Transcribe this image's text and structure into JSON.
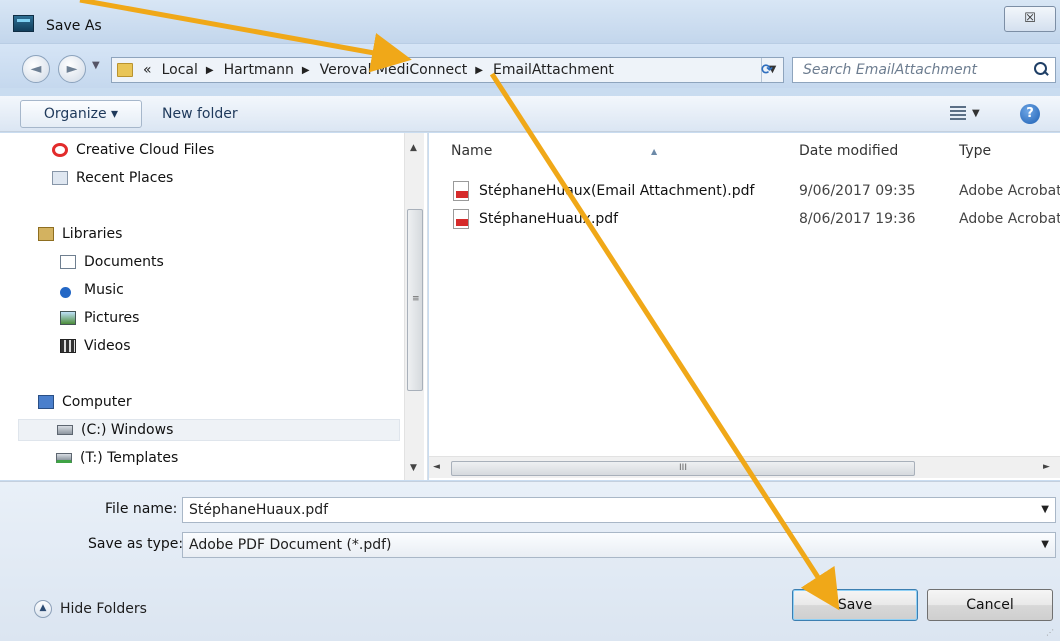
{
  "window": {
    "title": "Save As",
    "close_glyph": "☒"
  },
  "navigation": {
    "back_glyph": "◄",
    "forward_glyph": "►",
    "breadcrumb": [
      "«",
      "Local",
      "Hartmann",
      "Veroval MediConnect",
      "EmailAttachment"
    ],
    "separator": "▶",
    "search_placeholder": "Search EmailAttachment"
  },
  "toolbar": {
    "organize_label": "Organize ▾",
    "new_folder_label": "New folder",
    "help_glyph": "?"
  },
  "nav_pane": {
    "items": [
      {
        "label": "Creative Cloud Files",
        "icon": "creative-cloud-icon"
      },
      {
        "label": "Recent Places",
        "icon": "recent-places-icon"
      },
      {
        "label": "Libraries",
        "icon": "libraries-icon"
      },
      {
        "label": "Documents",
        "icon": "documents-icon"
      },
      {
        "label": "Music",
        "icon": "music-icon"
      },
      {
        "label": "Pictures",
        "icon": "pictures-icon"
      },
      {
        "label": "Videos",
        "icon": "videos-icon"
      },
      {
        "label": "Computer",
        "icon": "computer-icon"
      },
      {
        "label": "(C:) Windows",
        "icon": "drive-icon",
        "selected": true
      },
      {
        "label": "(T:) Templates",
        "icon": "network-drive-icon"
      }
    ]
  },
  "file_list": {
    "columns": [
      "Name",
      "Date modified",
      "Type"
    ],
    "files": [
      {
        "name": "StéphaneHuaux(Email Attachment).pdf",
        "date": "9/06/2017 09:35",
        "type": "Adobe Acrobat"
      },
      {
        "name": "StéphaneHuaux.pdf",
        "date": "8/06/2017 19:36",
        "type": "Adobe Acrobat"
      }
    ]
  },
  "form": {
    "file_name_label": "File name:",
    "file_name_value": "StéphaneHuaux.pdf",
    "save_type_label": "Save as type:",
    "save_type_value": "Adobe PDF Document (*.pdf)"
  },
  "footer": {
    "hide_folders_label": "Hide Folders",
    "save_label": "Save",
    "cancel_label": "Cancel"
  },
  "colors": {
    "annotation_arrow": "#f0a818",
    "window_frame": "#c9dcf0"
  }
}
